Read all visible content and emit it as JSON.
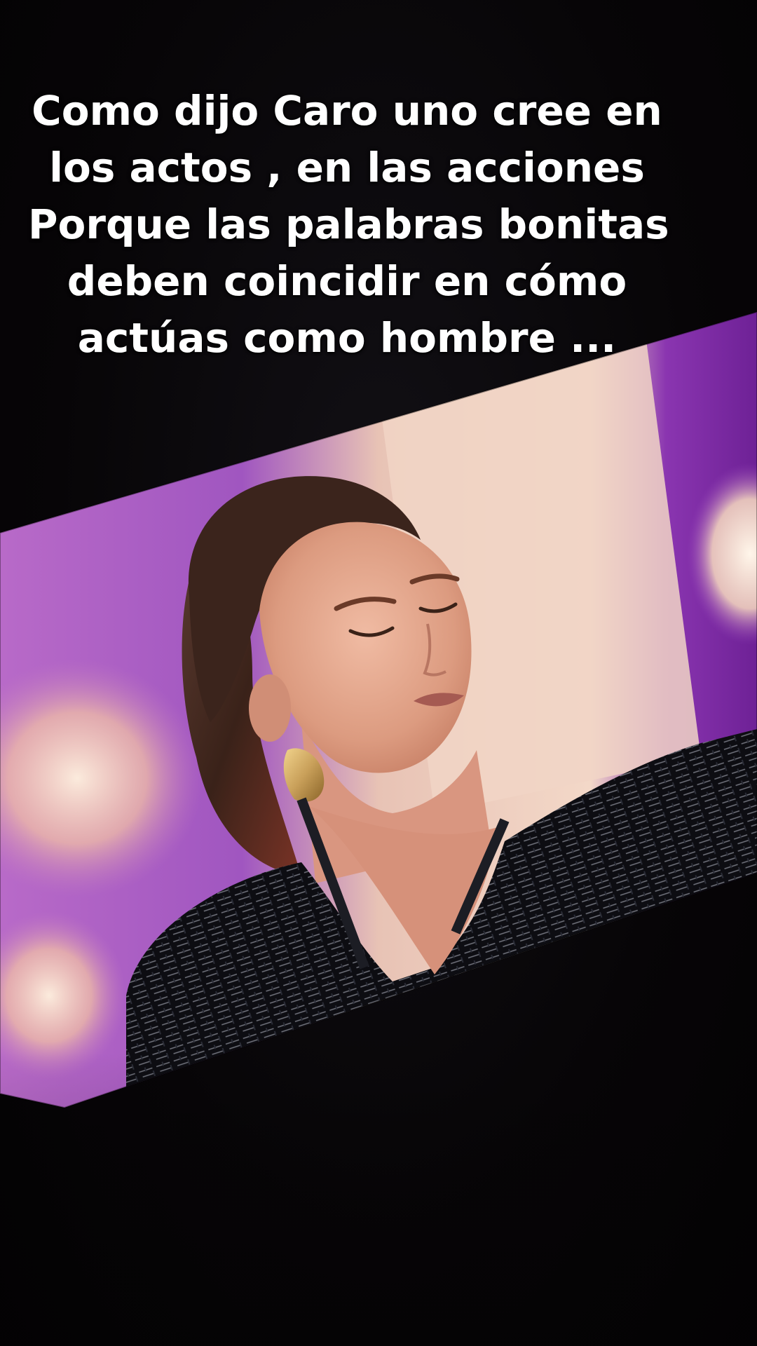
{
  "caption": {
    "lines": [
      "Como dijo Caro uno cree en",
      "los actos , en las acciones",
      "Porque las palabras bonitas",
      "deben coincidir en cómo",
      "actúas como hombre ..."
    ]
  },
  "scene": {
    "colors": {
      "background": "#060406",
      "studio_purple": "#9a4fc8",
      "studio_cream": "#f2d6c6",
      "jacket": "#101015",
      "hair": "#4a2a20",
      "skin": "#e3a78f",
      "earring_gold": "#c9a05a"
    }
  }
}
